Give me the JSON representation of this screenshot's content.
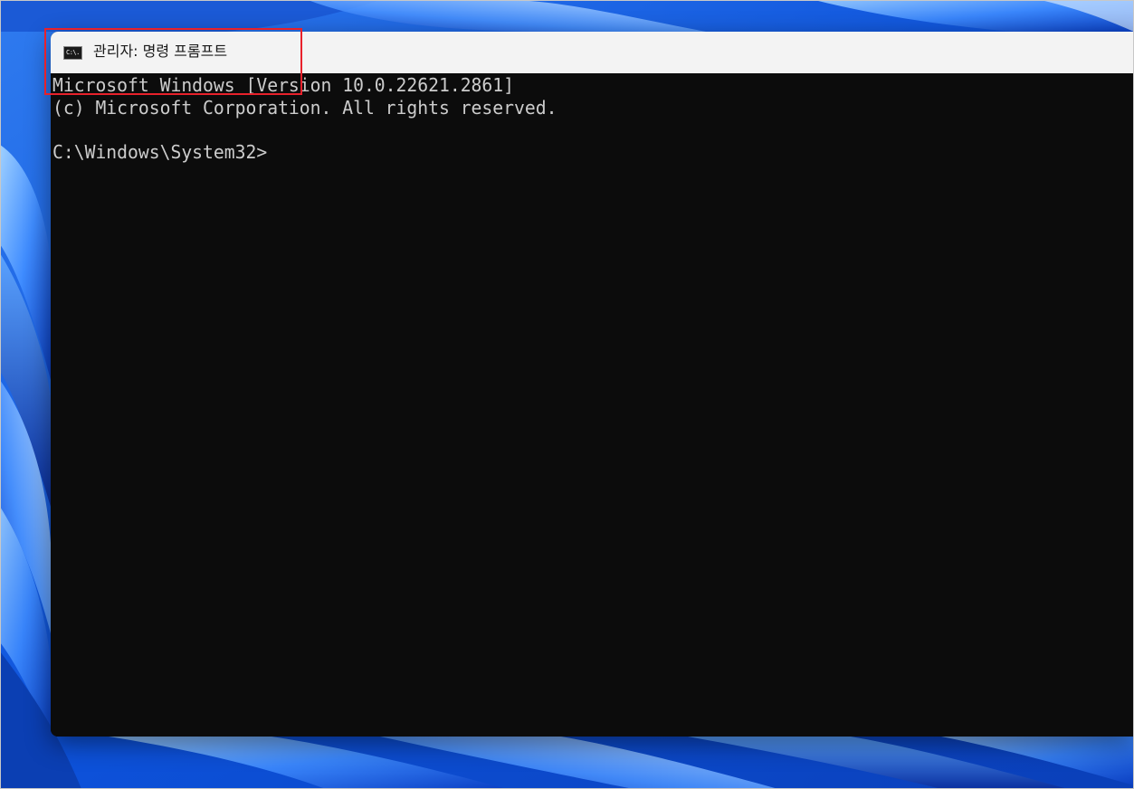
{
  "window": {
    "title": "관리자: 명령 프롬프트",
    "icon": "command-prompt-icon",
    "icon_text": "C:\\."
  },
  "console": {
    "lines": [
      "Microsoft Windows [Version 10.0.22621.2861]",
      "(c) Microsoft Corporation. All rights reserved.",
      "",
      "C:\\Windows\\System32>"
    ]
  },
  "colors": {
    "console_background": "#0c0c0c",
    "console_text": "#cccccc",
    "titlebar_background": "#f3f3f3",
    "highlight": "#e8212b",
    "wallpaper_accent": "#0a4fd8"
  }
}
